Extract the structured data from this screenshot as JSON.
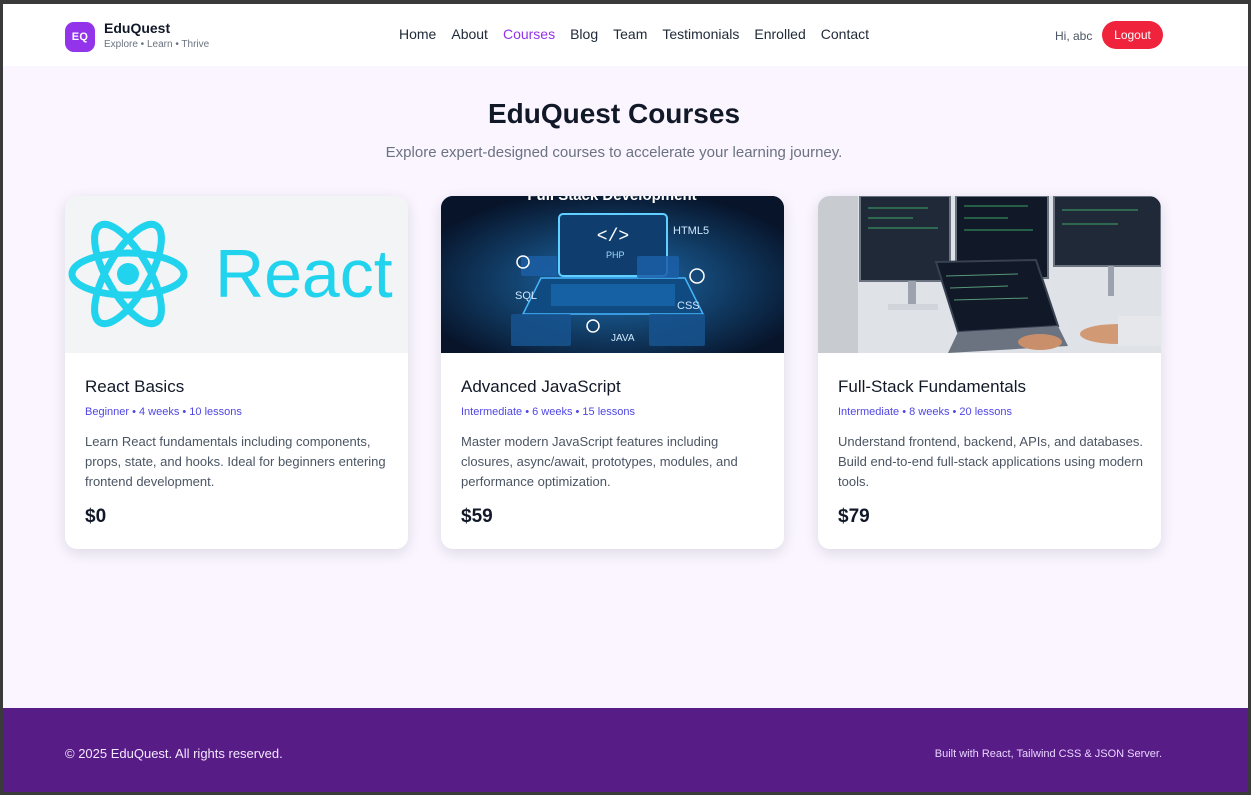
{
  "header": {
    "logo_initials": "EQ",
    "brand_name": "EduQuest",
    "tagline": "Explore • Learn • Thrive",
    "nav": [
      "Home",
      "About",
      "Courses",
      "Blog",
      "Team",
      "Testimonials",
      "Enrolled",
      "Contact"
    ],
    "active_nav": "Courses",
    "greeting": "Hi, abc",
    "logout_label": "Logout"
  },
  "hero": {
    "title": "EduQuest Courses",
    "subtitle": "Explore expert-designed courses to accelerate your learning journey."
  },
  "courses": [
    {
      "title": "React Basics",
      "meta": "Beginner • 4 weeks • 10 lessons",
      "description": "Learn React fundamentals including components, props, state, and hooks. Ideal for beginners entering frontend development.",
      "price": "$0",
      "image_text": "React"
    },
    {
      "title": "Advanced JavaScript",
      "meta": "Intermediate • 6 weeks • 15 lessons",
      "description": "Master modern JavaScript features including closures, async/await, prototypes, modules, and performance optimization.",
      "price": "$59",
      "image_text": "Full Stack Development",
      "image_labels": [
        "</>",
        "HTML5",
        "PHP",
        "SQL",
        "CSS",
        "JAVA"
      ]
    },
    {
      "title": "Full-Stack Fundamentals",
      "meta": "Intermediate • 8 weeks • 20 lessons",
      "description": "Understand frontend, backend, APIs, and databases. Build end-to-end full-stack applications using modern tools.",
      "price": "$79"
    }
  ],
  "footer": {
    "copyright": "© 2025 EduQuest. All rights reserved.",
    "built_with": "Built with React, Tailwind CSS & JSON Server."
  },
  "colors": {
    "accent": "#9333ea",
    "logout": "#ef233c",
    "footer": "#581c87",
    "meta": "#4f46e5",
    "background": "#faf5ff"
  }
}
